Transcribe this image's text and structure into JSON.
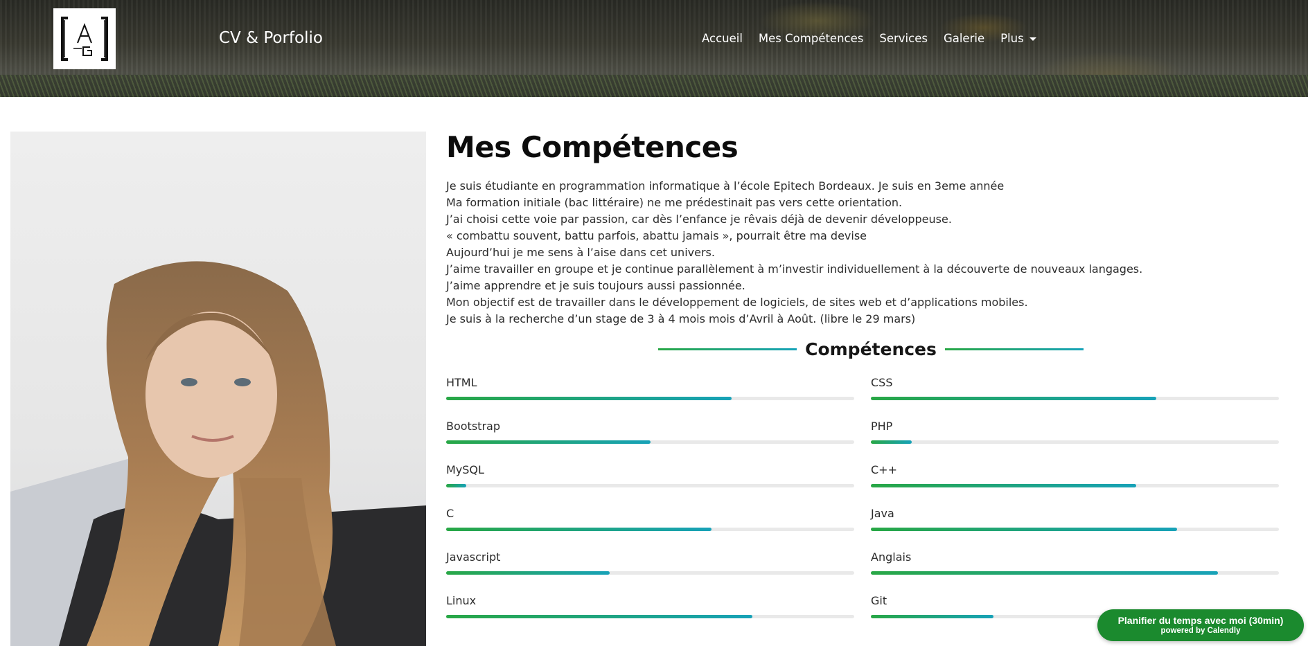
{
  "header": {
    "brand": "CV & Porfolio",
    "nav": [
      {
        "label": "Accueil"
      },
      {
        "label": "Mes Compétences"
      },
      {
        "label": "Services"
      },
      {
        "label": "Galerie"
      },
      {
        "label": "Plus"
      }
    ]
  },
  "main": {
    "title": "Mes Compétences",
    "bio": [
      "Je suis étudiante en programmation informatique à l’école Epitech Bordeaux. Je suis en 3eme année",
      "Ma formation initiale (bac littéraire) ne me prédestinait pas vers cette orientation.",
      "J’ai choisi cette voie par passion, car dès l’enfance je rêvais déjà de devenir développeuse.",
      "« combattu souvent, battu parfois, abattu jamais », pourrait être ma devise",
      "Aujourd’hui je me sens à l’aise dans cet univers.",
      "J’aime travailler en groupe et je continue parallèlement à m’investir individuellement à la découverte de nouveaux langages.",
      "J’aime apprendre et je suis toujours aussi passionnée.",
      "Mon objectif est de travailler dans le développement de logiciels, de sites web et d’applications mobiles.",
      "Je suis à la recherche d’un stage de 3 à 4 mois mois d’Avril à Août. (libre le 29 mars)"
    ],
    "skills_title": "Compétences",
    "skills": [
      {
        "name": "HTML",
        "level": 70
      },
      {
        "name": "CSS",
        "level": 70
      },
      {
        "name": "Bootstrap",
        "level": 50
      },
      {
        "name": "PHP",
        "level": 10
      },
      {
        "name": "MySQL",
        "level": 5
      },
      {
        "name": "C++",
        "level": 65
      },
      {
        "name": "C",
        "level": 65
      },
      {
        "name": "Java",
        "level": 75
      },
      {
        "name": "Javascript",
        "level": 40
      },
      {
        "name": "Anglais",
        "level": 85
      },
      {
        "name": "Linux",
        "level": 75
      },
      {
        "name": "Git",
        "level": 30
      }
    ]
  },
  "calendly": {
    "line1": "Planifier du temps avec moi (30min)",
    "line2": "powered by Calendly"
  },
  "colors": {
    "bar_start": "#28a745",
    "bar_end": "#17a2b8",
    "calendly_bg": "#1b8a2e"
  }
}
